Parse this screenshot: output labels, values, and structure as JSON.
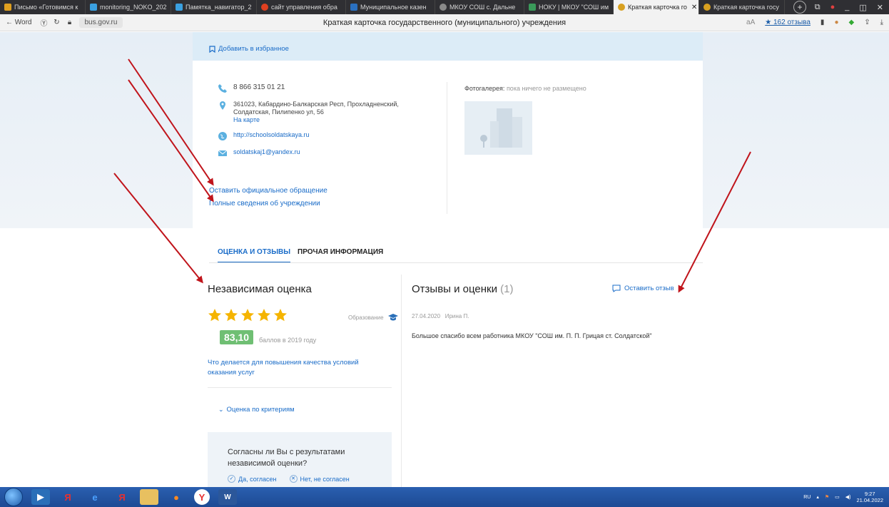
{
  "browser": {
    "tabs": [
      {
        "label": "Письмо «Готовимся к",
        "color": "#e0a020"
      },
      {
        "label": "monitoring_NOKO_202",
        "color": "#3aa0e0"
      },
      {
        "label": "Памятка_навигатор_2",
        "color": "#3aa0e0"
      },
      {
        "label": "сайт управления обра",
        "color": "#e04020"
      },
      {
        "label": "Муниципальное казен",
        "color": "#2a70c0"
      },
      {
        "label": "МКОУ СОШ с. Дальне",
        "color": "#8a8a8a"
      },
      {
        "label": "НОКУ | МКОУ \"СОШ им",
        "color": "#3a9a5a"
      },
      {
        "label": "Краткая карточка го",
        "color": "#d8a020"
      },
      {
        "label": "Краткая карточка госу",
        "color": "#d8a020"
      }
    ],
    "active_tab_index": 7,
    "new_tab": "+",
    "back_label": "← Word",
    "url": "bus.gov.ru",
    "page_title": "Краткая карточка государственного (муниципального) учреждения",
    "reviews_badge": "★ 162 отзыва"
  },
  "card": {
    "favorite_link": "Добавить в избранное",
    "phone": "8 866 315 01 21",
    "address_lines": [
      "361023, Кабардино-Балкарская Респ, Прохладненский,",
      "Солдатская, Пилипенко ул, 56"
    ],
    "map_link": "На карте",
    "website": "http://schoolsoldatskaya.ru",
    "email": "soldatskaj1@yandex.ru",
    "gallery_label": "Фотогалерея:",
    "gallery_empty": "пока ничего не размещено",
    "appeal_link": "Оставить официальное обращение",
    "full_info_link": "Полные сведения об учреждении"
  },
  "tabs": {
    "rating": "ОЦЕНКА И ОТЗЫВЫ",
    "other": "ПРОЧАЯ ИНФОРМАЦИЯ"
  },
  "independent": {
    "title": "Независимая оценка",
    "stars": 5,
    "category": "Образование",
    "score": "83,10",
    "score_note": "баллов в 2019 году",
    "improve_link": "Что делается для повышения качества условий оказания услуг",
    "criteria_link": "Оценка по критериям",
    "agree_question": "Согласны ли Вы с результатами независимой оценки?",
    "agree_yes": "Да, согласен",
    "agree_no": "Нет, не согласен"
  },
  "reviews": {
    "title": "Отзывы и оценки",
    "count": "(1)",
    "leave_review": "Оставить отзыв",
    "items": [
      {
        "date": "27.04.2020",
        "author": "Ирина П.",
        "text": "Большое спасибо всем работника МКОУ \"СОШ им. П. П. Грицая ст. Солдатской\""
      }
    ]
  },
  "taskbar": {
    "lang": "RU",
    "time": "9:27",
    "date": "21.04.2022"
  },
  "colors": {
    "accent": "#1a6cc8",
    "star": "#f5b400",
    "score_bg": "#6fbf73",
    "arrow": "#c0141b"
  }
}
